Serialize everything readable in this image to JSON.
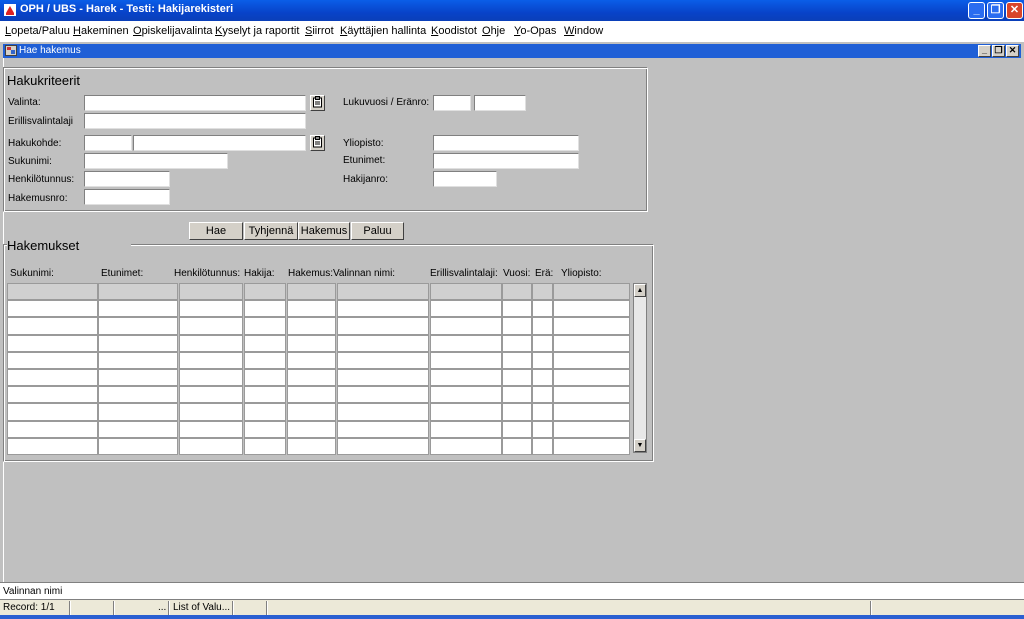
{
  "window": {
    "title": "OPH / UBS - Harek - Testi: Hakijarekisteri",
    "minimize": "_",
    "restore": "❐",
    "close": "✕"
  },
  "menu": [
    "Lopeta/Paluu",
    "Hakeminen",
    "Opiskelijavalinta",
    "Kyselyt ja raportit",
    "Siirrot",
    "Käyttäjien hallinta",
    "Koodistot",
    "Ohje",
    "Yo-Opas",
    "Window"
  ],
  "child": {
    "title": "Hae hakemus",
    "minimize": "_",
    "restore": "❐",
    "close": "✕"
  },
  "criteria": {
    "title": "Hakukriteerit",
    "valinta": "Valinta:",
    "erillisvalintalaji": "Erillisvalintalaji",
    "hakukohde": "Hakukohde:",
    "sukunimi": "Sukunimi:",
    "henkilotunnus": "Henkilötunnus:",
    "hakemusnro": "Hakemusnro:",
    "lukuvuosi": "Lukuvuosi / Eränro:",
    "yliopisto": "Yliopisto:",
    "etunimet": "Etunimet:",
    "hakijanro": "Hakijanro:"
  },
  "buttons": {
    "hae": "Hae",
    "tyhjenna": "Tyhjennä",
    "hakemus": "Hakemus",
    "paluu": "Paluu"
  },
  "results": {
    "title": "Hakemukset",
    "columns": [
      "Sukunimi:",
      "Etunimet:",
      "Henkilötunnus:",
      "Hakija:",
      "Hakemus:",
      "Valinnan nimi:",
      "Erillisvalintalaji:",
      "Vuosi:",
      "Erä:",
      "Yliopisto:"
    ]
  },
  "status": {
    "message": "Valinnan nimi",
    "record": "Record: 1/1",
    "ellipsis": "...",
    "lov": "List of Valu..."
  },
  "colors": {
    "titlebar": "#0843c9",
    "child_titlebar": "#1f5fd6",
    "background": "#c0c0c0"
  }
}
